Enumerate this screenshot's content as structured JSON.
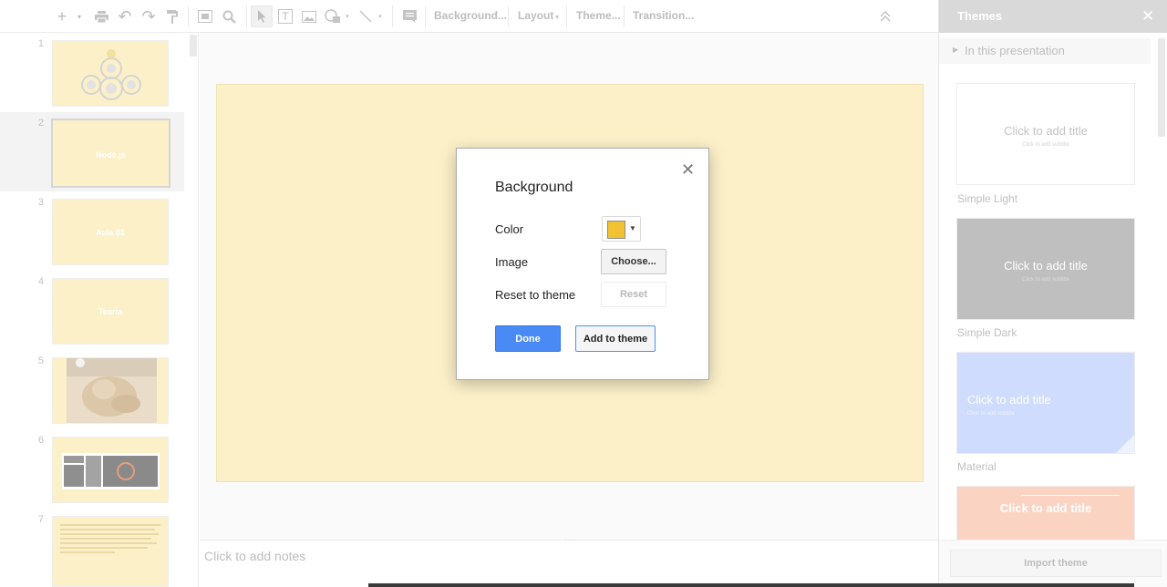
{
  "toolbar": {
    "items": [
      {
        "name": "new-slide-icon",
        "glyph": "+"
      },
      {
        "name": "new-slide-menu-icon",
        "glyph": "▾"
      },
      {
        "name": "print-icon"
      },
      {
        "name": "undo-icon",
        "glyph": "↶"
      },
      {
        "name": "redo-icon",
        "glyph": "↷"
      },
      {
        "name": "paint-format-icon"
      },
      {
        "name": "fit-icon"
      },
      {
        "name": "zoom-icon"
      },
      {
        "name": "select-icon"
      },
      {
        "name": "text-box-icon",
        "glyph": "T"
      },
      {
        "name": "image-icon"
      },
      {
        "name": "shape-icon"
      },
      {
        "name": "line-icon"
      },
      {
        "name": "comment-icon"
      },
      {
        "name": "collapse-icon",
        "glyph": "⌃"
      }
    ],
    "background_label": "Background...",
    "layout_label": "Layout",
    "theme_label": "Theme...",
    "transition_label": "Transition..."
  },
  "filmstrip": {
    "slides": [
      {
        "number": "1",
        "title": ""
      },
      {
        "number": "2",
        "title": "Node.js"
      },
      {
        "number": "3",
        "title": "Aula 01"
      },
      {
        "number": "4",
        "title": "Teoria"
      },
      {
        "number": "5",
        "title": ""
      },
      {
        "number": "6",
        "title": ""
      },
      {
        "number": "7",
        "title": ""
      }
    ]
  },
  "notes": {
    "placeholder": "Click to add notes"
  },
  "themes_panel": {
    "title": "Themes",
    "close_glyph": "✕",
    "in_presentation_label": "In this presentation",
    "themes": [
      {
        "name": "Simple Light",
        "card_title": "Click to add title",
        "card_subtitle": "Click to add subtitle",
        "bg": "#ffffff",
        "fg": "#c4c4c4"
      },
      {
        "name": "Simple Dark",
        "card_title": "Click to add title",
        "card_subtitle": "Click to add subtitle",
        "bg": "#bfbfbf",
        "fg": "#ffffff"
      },
      {
        "name": "Material",
        "card_title": "Click to add title",
        "card_subtitle": "Click to add subtitle",
        "bg": "#cfdcfd",
        "fg": "#ffffff"
      },
      {
        "name": "",
        "card_title": "Click to add title",
        "card_subtitle": "",
        "bg": "#fbd3c3",
        "fg": "#ffffff"
      }
    ],
    "import_label": "Import theme"
  },
  "dialog": {
    "title": "Background",
    "close_glyph": "✕",
    "color_label": "Color",
    "color_value": "#f1c232",
    "image_label": "Image",
    "choose_label": "Choose...",
    "reset_theme_label": "Reset to theme",
    "reset_label": "Reset",
    "done_label": "Done",
    "add_theme_label": "Add to theme"
  },
  "colors": {
    "accent": "#4a8af4",
    "slide_background": "#fbf0c8"
  }
}
